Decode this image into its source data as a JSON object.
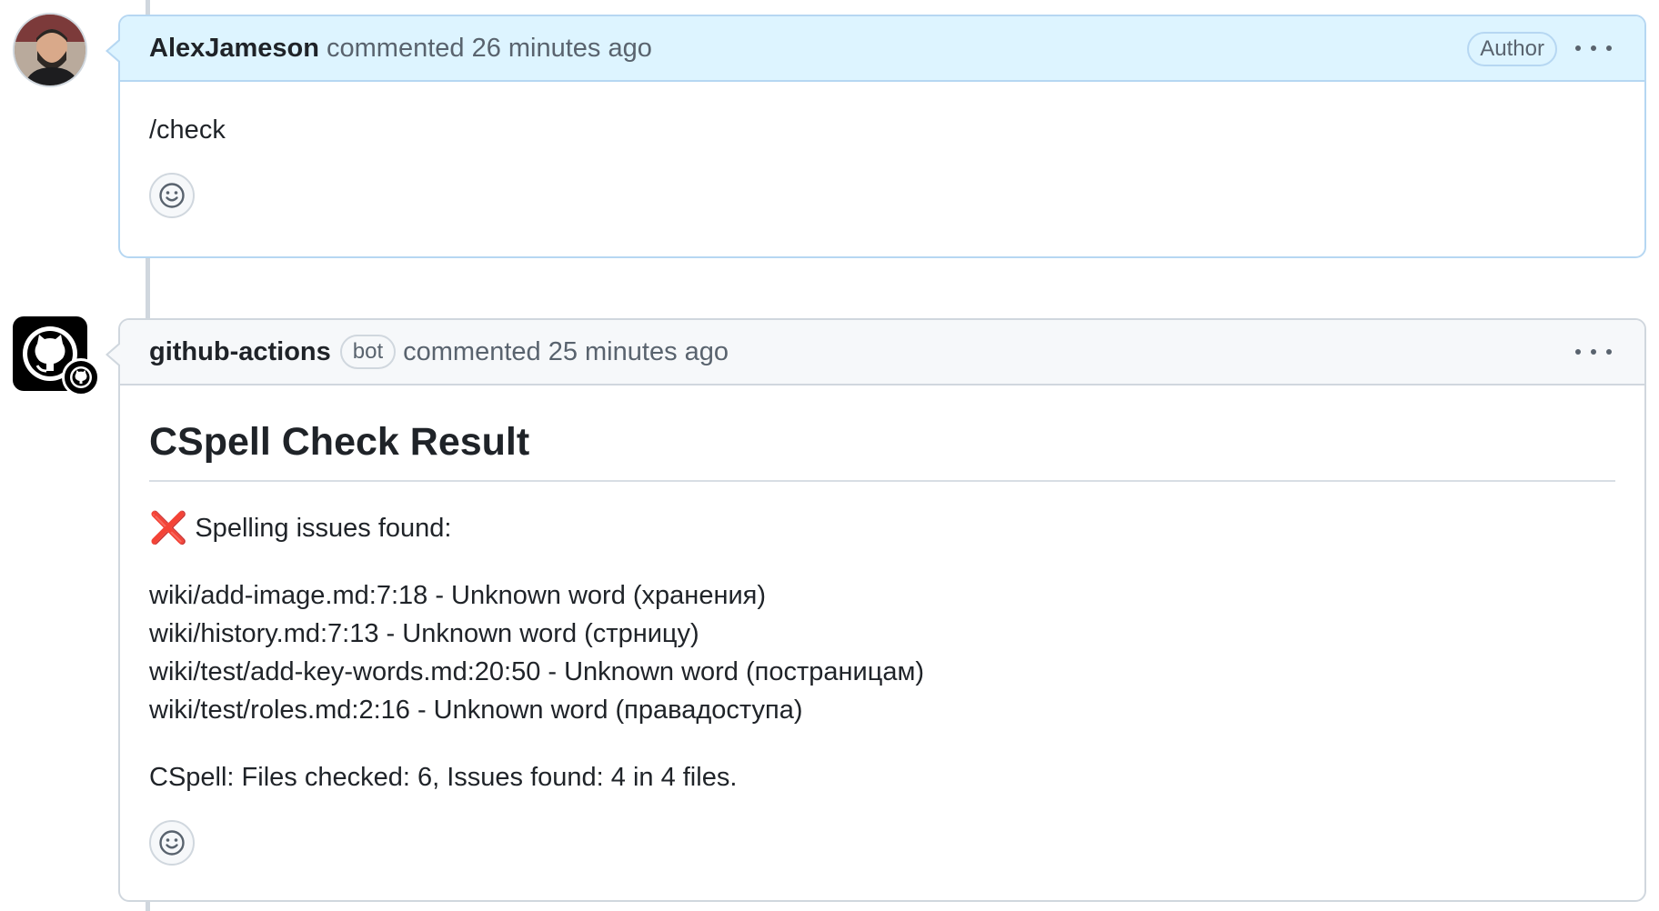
{
  "comments": [
    {
      "username": "AlexJameson",
      "meta": "commented 26 minutes ago",
      "badge": "Author",
      "body": "/check"
    },
    {
      "username": "github-actions",
      "badge": "bot",
      "meta": "commented 25 minutes ago",
      "title": "CSpell Check Result",
      "status_icon": "❌",
      "status_text": "Spelling issues found:",
      "issues": [
        "wiki/add-image.md:7:18 - Unknown word (хранения)",
        "wiki/history.md:7:13 - Unknown word (стрницу)",
        "wiki/test/add-key-words.md:20:50 - Unknown word (постраницам)",
        "wiki/test/roles.md:2:16 - Unknown word (правадоступа)"
      ],
      "summary": "CSpell: Files checked: 6, Issues found: 4 in 4 files."
    }
  ],
  "icons": {
    "reaction": "smiley-icon",
    "menu": "kebab-horizontal-icon",
    "bot_avatar": "github-octocat-icon"
  },
  "colors": {
    "author_header_bg": "#ddf4ff",
    "bot_header_bg": "#f6f8fa",
    "error_red": "#da3633",
    "border": "#d0d7de"
  }
}
